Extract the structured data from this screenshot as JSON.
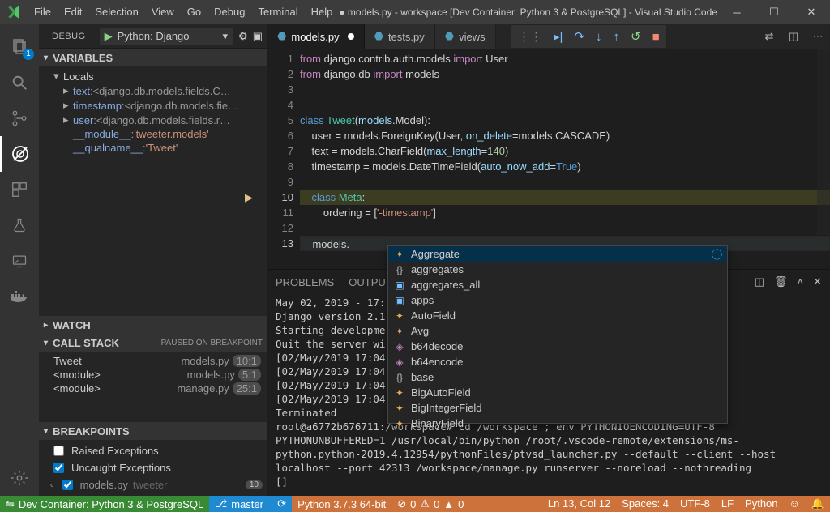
{
  "window": {
    "title": "● models.py - workspace [Dev Container: Python 3 & PostgreSQL] - Visual Studio Code -..."
  },
  "menu": [
    "File",
    "Edit",
    "Selection",
    "View",
    "Go",
    "Debug",
    "Terminal",
    "Help"
  ],
  "debug": {
    "label": "DEBUG",
    "config": "Python: Django"
  },
  "sidebar": {
    "variables": {
      "title": "VARIABLES",
      "scope": "Locals",
      "items": [
        {
          "name": "text",
          "value": "<django.db.models.fields.C…"
        },
        {
          "name": "timestamp",
          "value": "<django.db.models.fie…"
        },
        {
          "name": "user",
          "value": "<django.db.models.fields.r…"
        }
      ],
      "extras": [
        {
          "name": "__module__",
          "value": "'tweeter.models'"
        },
        {
          "name": "__qualname__",
          "value": "'Tweet'"
        }
      ]
    },
    "watch": {
      "title": "WATCH"
    },
    "callstack": {
      "title": "CALL STACK",
      "status": "PAUSED ON BREAKPOINT",
      "frames": [
        {
          "name": "Tweet",
          "src": "models.py",
          "line": "10:1"
        },
        {
          "name": "<module>",
          "src": "models.py",
          "line": "5:1"
        },
        {
          "name": "<module>",
          "src": "manage.py",
          "line": "25:1"
        }
      ]
    },
    "breakpoints": {
      "title": "BREAKPOINTS",
      "items": [
        {
          "label": "Raised Exceptions",
          "checked": false
        },
        {
          "label": "Uncaught Exceptions",
          "checked": true
        }
      ],
      "bp": {
        "file": "models.py",
        "module": "tweeter",
        "line": "10"
      }
    }
  },
  "tabs": [
    {
      "label": "models.py",
      "dirty": true,
      "active": true
    },
    {
      "label": "tests.py",
      "dirty": false,
      "active": false
    },
    {
      "label": "views",
      "dirty": false,
      "active": false
    }
  ],
  "code": {
    "lines": [
      "from django.contrib.auth.models import User",
      "from django.db import models",
      "",
      "",
      "class Tweet(models.Model):",
      "    user = models.ForeignKey(User, on_delete=models.CASCADE)",
      "    text = models.CharField(max_length=140)",
      "    timestamp = models.DateTimeField(auto_now_add=True)",
      "",
      "    class Meta:",
      "        ordering = ['-timestamp']",
      "",
      "    models."
    ]
  },
  "autocomplete": {
    "items": [
      {
        "icon": "fn",
        "label": "Aggregate",
        "selected": true,
        "info": true
      },
      {
        "icon": "ns",
        "label": "aggregates"
      },
      {
        "icon": "var",
        "label": "aggregates_all"
      },
      {
        "icon": "var",
        "label": "apps"
      },
      {
        "icon": "fn",
        "label": "AutoField"
      },
      {
        "icon": "fn",
        "label": "Avg"
      },
      {
        "icon": "fn",
        "label": "b64decode"
      },
      {
        "icon": "fn",
        "label": "b64encode"
      },
      {
        "icon": "ns",
        "label": "base"
      },
      {
        "icon": "fn",
        "label": "BigAutoField"
      },
      {
        "icon": "fn",
        "label": "BigIntegerField"
      },
      {
        "icon": "fn",
        "label": "BinaryField"
      }
    ]
  },
  "panel": {
    "tabs": [
      "PROBLEMS",
      "OUTPUT"
    ],
    "text": "May 02, 2019 - 17:\nDjango version 2.1\nStarting developme\nQuit the server wi\n[02/May/2019 17:04\n[02/May/2019 17:04\n[02/May/2019 17:04\n[02/May/2019 17:04\nTerminated\nroot@a6772b676711:/workspace# cd /workspace ; env PYTHONIOENCODING=UTF-8 PYTHONUNBUFFERED=1 /usr/local/bin/python /root/.vscode-remote/extensions/ms-python.python-2019.4.12954/pythonFiles/ptvsd_launcher.py --default --client --host localhost --port 42313 /workspace/manage.py runserver --noreload --nothreading\n[]"
  },
  "status": {
    "remote": "Dev Container: Python 3 & PostgreSQL",
    "branch": "master",
    "python": "Python 3.7.3 64-bit",
    "errors": "0",
    "warnings": "0",
    "other": "0",
    "ln": "Ln 13, Col 12",
    "spaces": "Spaces: 4",
    "enc": "UTF-8",
    "eol": "LF",
    "lang": "Python",
    "smile": "☺",
    "bell": "🔔"
  }
}
